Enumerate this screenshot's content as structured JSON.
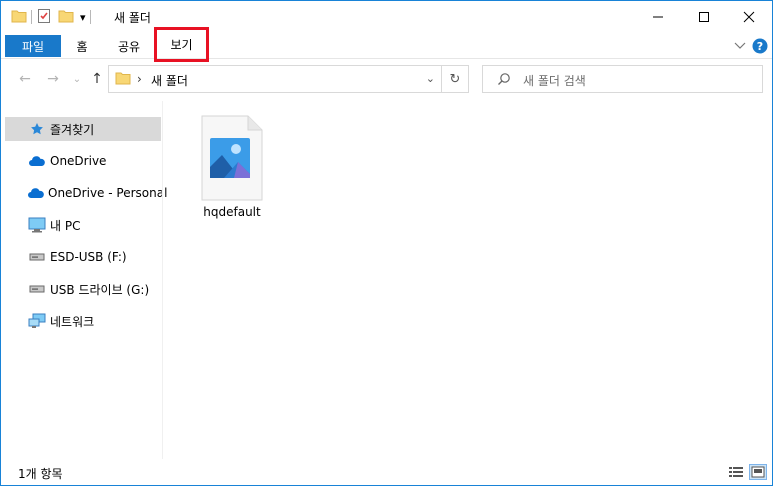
{
  "window": {
    "title": "새 폴더",
    "controls": {
      "minimize": "—",
      "maximize": "☐",
      "close": "✕"
    }
  },
  "quick_access": {
    "dropdown": "▾"
  },
  "ribbon": {
    "tabs": [
      {
        "label": "파일"
      },
      {
        "label": "홈"
      },
      {
        "label": "공유"
      },
      {
        "label": "보기"
      }
    ],
    "expand_icon": "⌄",
    "help_icon": "?"
  },
  "navigation": {
    "back": "←",
    "forward": "→",
    "recent": "⌄",
    "up": "↑",
    "address_separator": "›",
    "address_path": "새 폴더",
    "address_dropdown": "⌄",
    "refresh": "↻",
    "search_placeholder": "새 폴더 검색"
  },
  "sidebar": {
    "items": [
      {
        "label": "즐겨찾기",
        "icon": "star-icon"
      },
      {
        "label": "OneDrive",
        "icon": "cloud-icon"
      },
      {
        "label": "OneDrive - Personal",
        "icon": "cloud-icon"
      },
      {
        "label": "내 PC",
        "icon": "monitor-icon"
      },
      {
        "label": "ESD-USB (F:)",
        "icon": "drive-icon"
      },
      {
        "label": "USB 드라이브 (G:)",
        "icon": "drive-icon"
      },
      {
        "label": "네트워크",
        "icon": "network-icon"
      }
    ]
  },
  "content": {
    "files": [
      {
        "name": "hqdefault",
        "icon": "image-file-icon"
      }
    ]
  },
  "status": {
    "item_count": "1개 항목"
  },
  "colors": {
    "accent": "#1979ca",
    "highlight": "#e81123",
    "sidebar_selected": "#d9d9d9"
  }
}
